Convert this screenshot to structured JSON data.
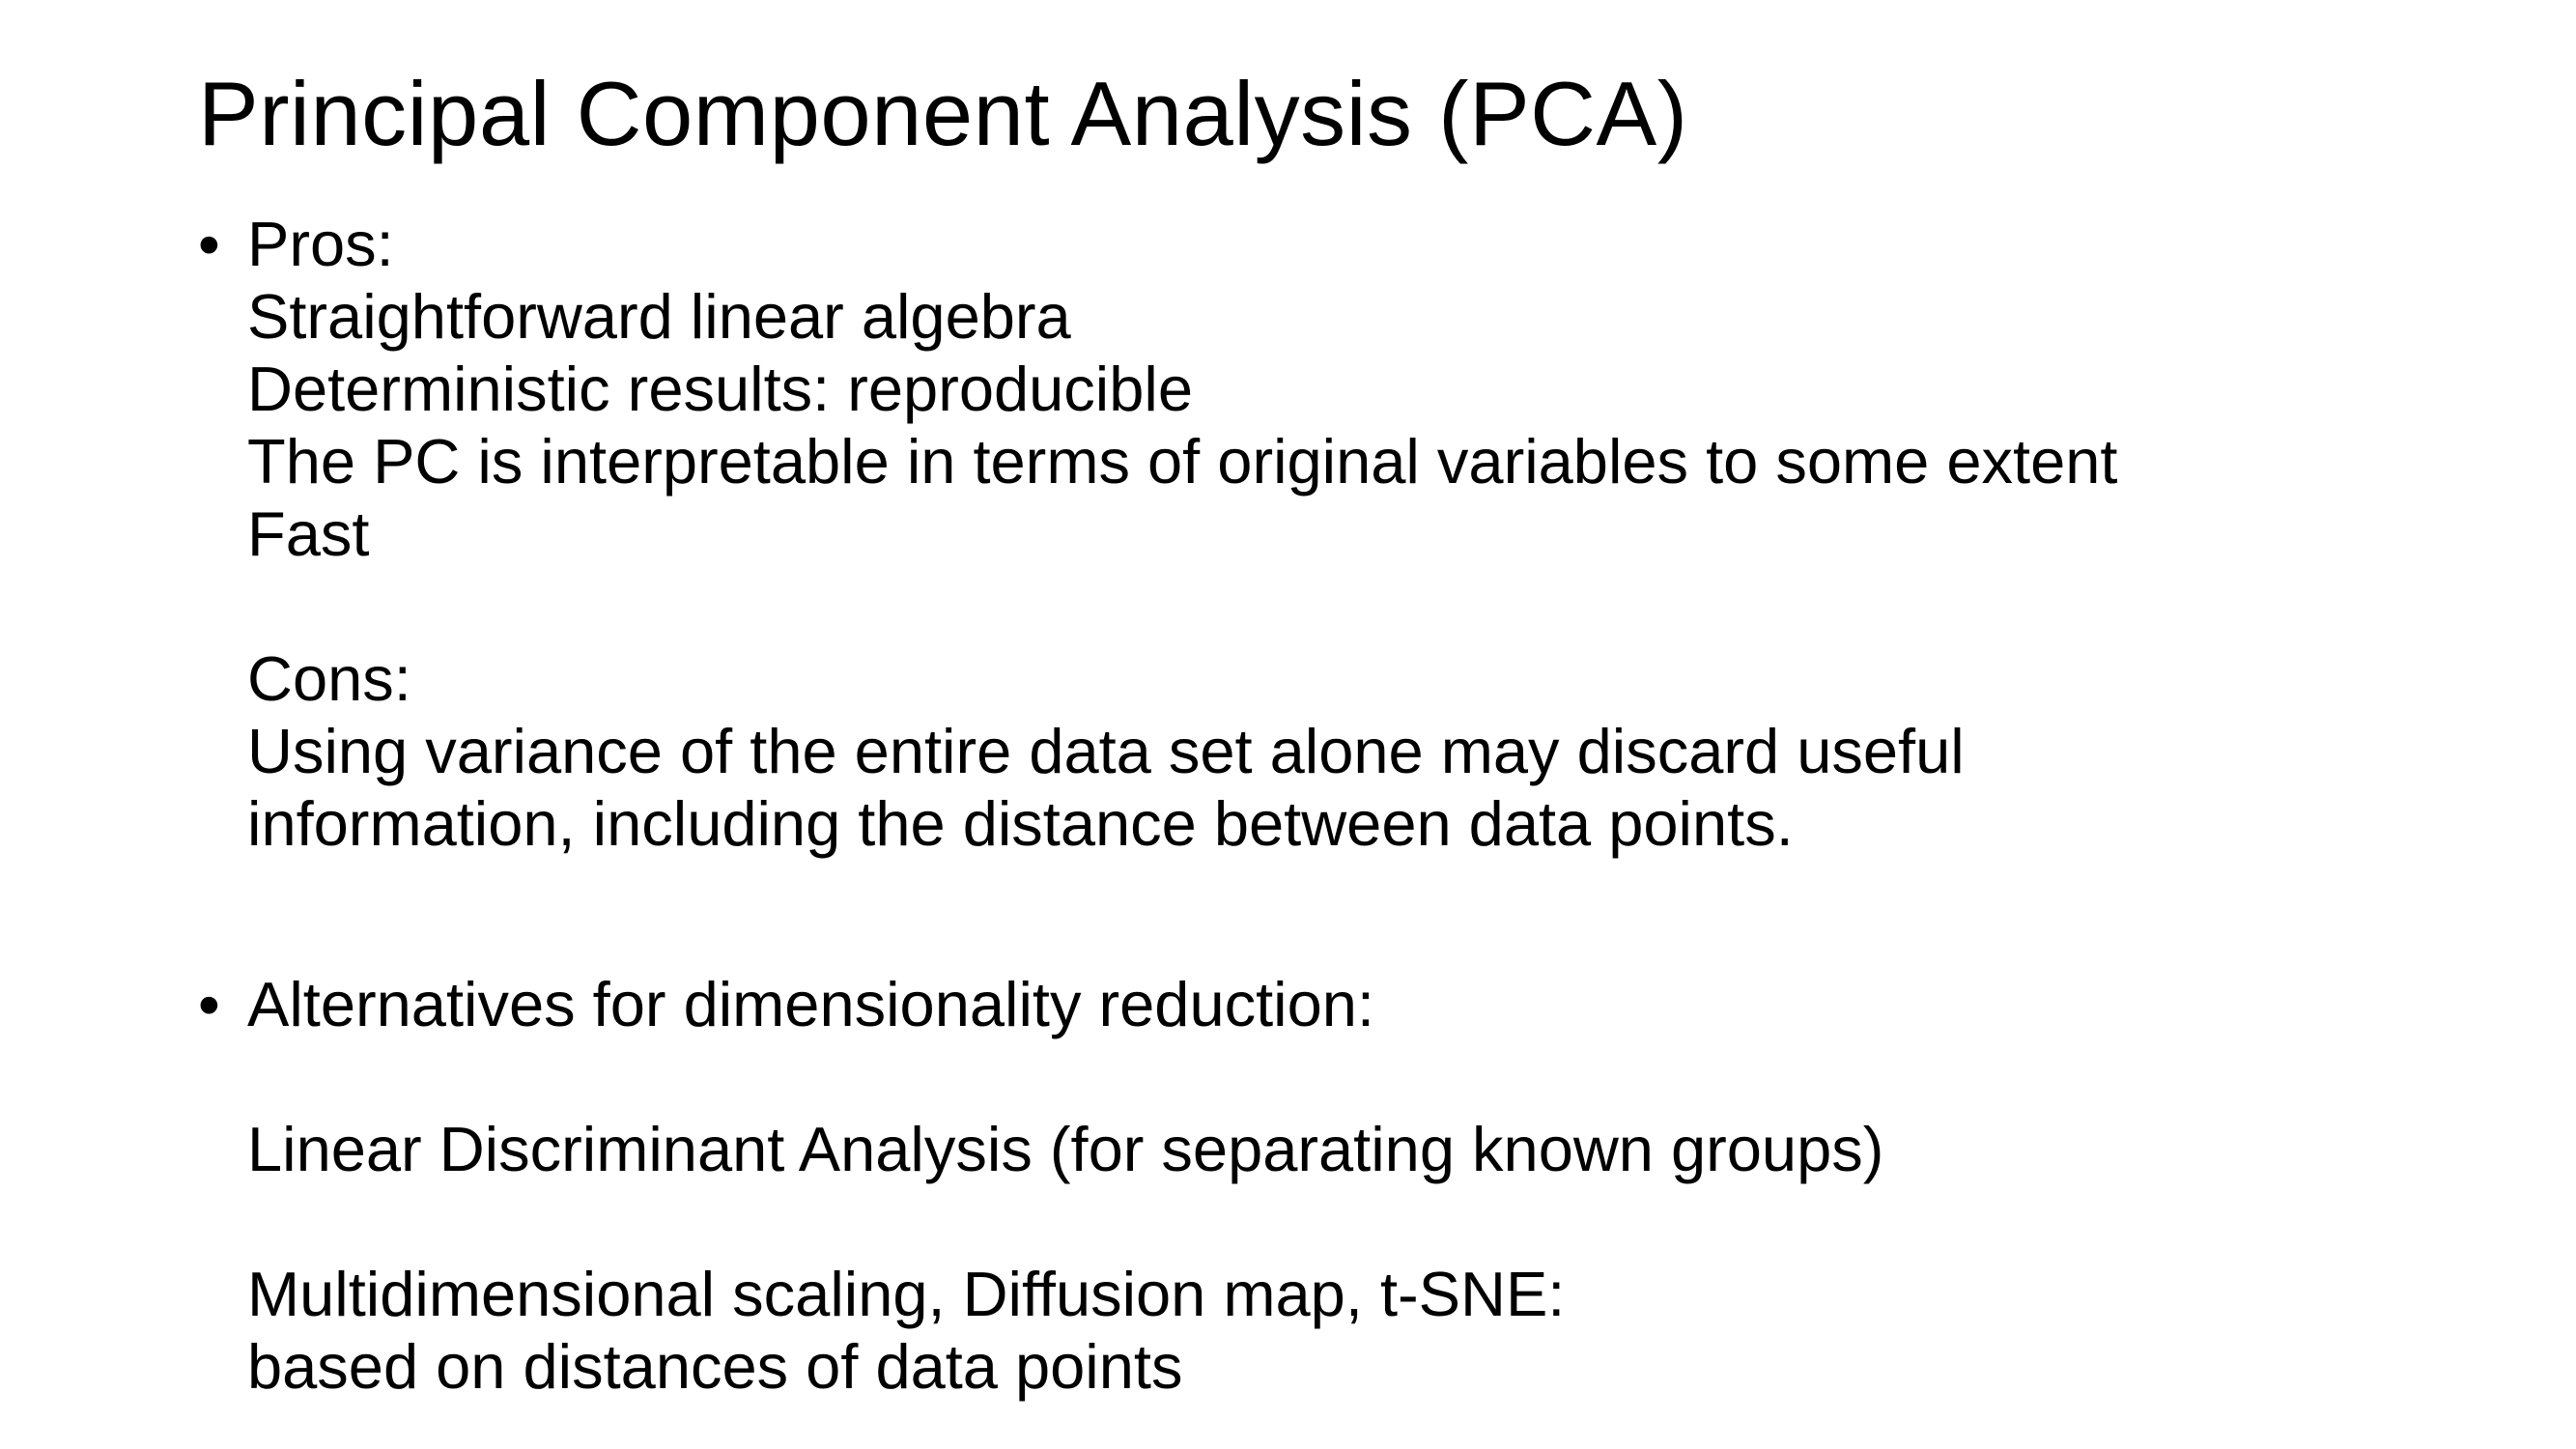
{
  "slide": {
    "title": "Principal Component Analysis (PCA)",
    "bullets": [
      {
        "marker": "•",
        "lines": [
          "Pros:",
          "Straightforward linear algebra",
          "Deterministic results: reproducible",
          "The PC is interpretable in terms of original variables to some extent",
          "Fast",
          "",
          "Cons:",
          "Using variance of the entire data set alone may discard useful",
          "information, including the distance between data points."
        ]
      },
      {
        "marker": "•",
        "lines": [
          "Alternatives for dimensionality reduction:",
          "",
          "Linear Discriminant Analysis (for separating known groups)",
          "",
          "Multidimensional scaling, Diffusion map, t-SNE:",
          "based on distances of data points"
        ]
      }
    ]
  }
}
